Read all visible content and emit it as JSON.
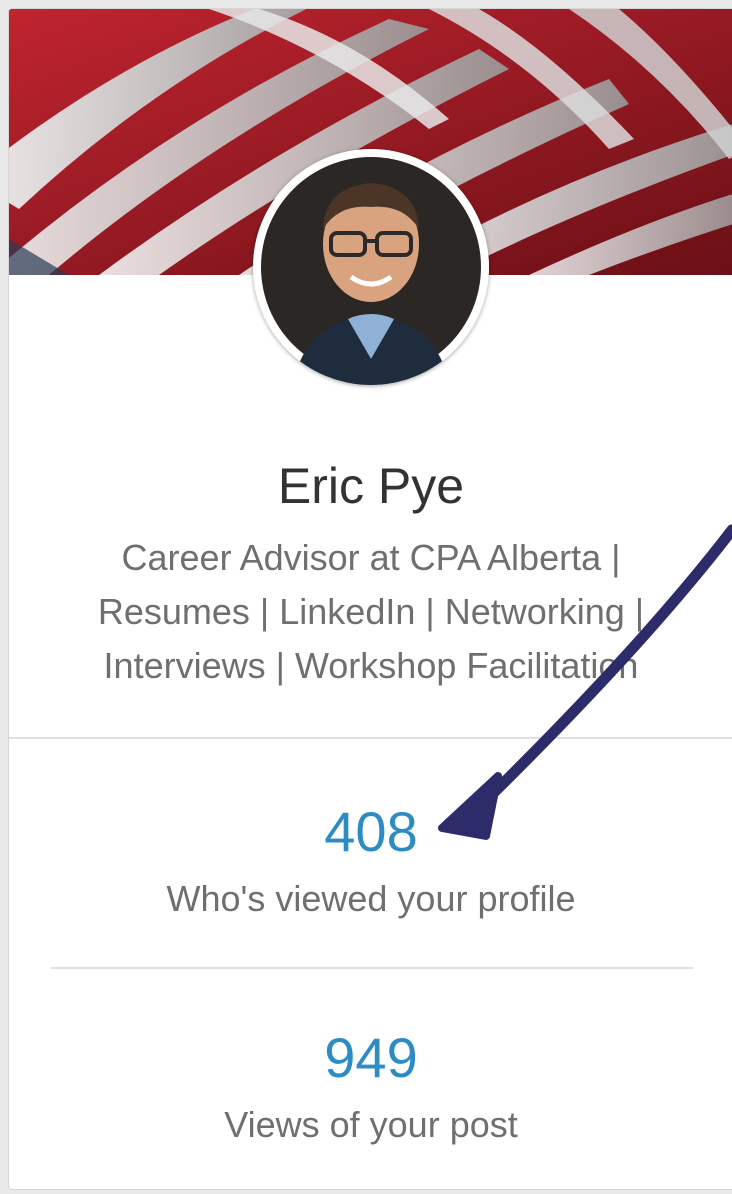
{
  "profile": {
    "name": "Eric Pye",
    "headline_lines": [
      "Career Advisor at CPA Alberta |",
      "Resumes | LinkedIn | Networking |",
      "Interviews | Workshop Facilitation"
    ]
  },
  "stats": [
    {
      "value": "408",
      "label": "Who's viewed your profile"
    },
    {
      "value": "949",
      "label": "Views of your post"
    }
  ],
  "colors": {
    "stat_value": "#2c8cc4",
    "annotation_arrow": "#2e2b6b",
    "banner_red": "#a31b28"
  },
  "icons": {
    "annotation": "arrow-pointing-icon"
  }
}
